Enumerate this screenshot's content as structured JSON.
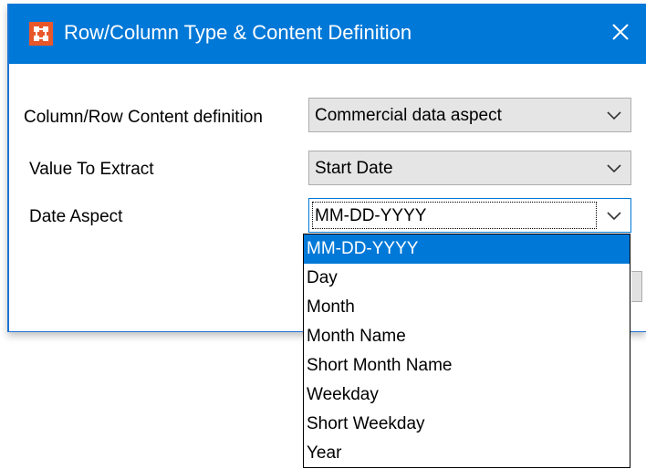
{
  "dialog": {
    "title": "Row/Column Type & Content Definition",
    "icon": "app-grid-icon",
    "close_icon": "close-icon"
  },
  "fields": [
    {
      "label": "Column/Row Content definition",
      "value": "Commercial data aspect"
    },
    {
      "label": "Value To Extract",
      "value": "Start Date"
    },
    {
      "label": "Date Aspect",
      "value": "MM-DD-YYYY"
    }
  ],
  "dropdown": {
    "options": [
      "MM-DD-YYYY",
      "Day",
      "Month",
      "Month Name",
      "Short Month Name",
      "Weekday",
      "Short Weekday",
      "Year"
    ],
    "selected_index": 0
  },
  "colors": {
    "accent": "#0078d7",
    "icon_bg": "#e8572a",
    "combo_bg": "#e5e5e5"
  }
}
